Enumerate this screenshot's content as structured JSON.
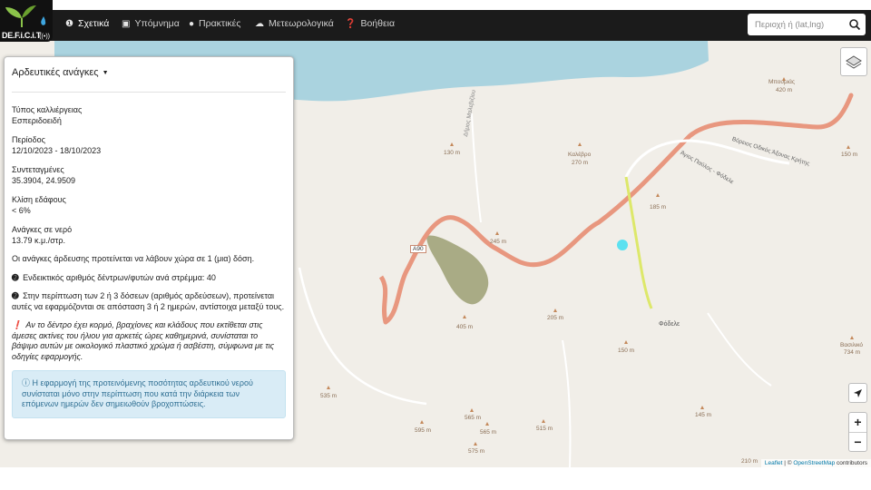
{
  "navbar": {
    "brand": "DE.F.i.C.i.T",
    "items": [
      {
        "label": "Σχετικά",
        "icon": "info-circle-icon",
        "active": true
      },
      {
        "label": "Υπόμνημα",
        "icon": "image-icon",
        "active": false
      },
      {
        "label": "Πρακτικές",
        "icon": "water-drop-icon",
        "active": false
      },
      {
        "label": "Μετεωρολογικά",
        "icon": "cloud-icon",
        "active": false
      },
      {
        "label": "Βοήθεια",
        "icon": "question-circle-icon",
        "active": false
      }
    ],
    "search": {
      "placeholder": "Περιοχή ή (lat,lng)",
      "value": ""
    }
  },
  "panel": {
    "title": "Αρδευτικές ανάγκες",
    "fields": [
      {
        "label": "Τύπος καλλιέργειας",
        "value": "Εσπεριδοειδή"
      },
      {
        "label": "Περίοδος",
        "value": "12/10/2023 - 18/10/2023"
      },
      {
        "label": "Συντεταγμένες",
        "value": "35.3904, 24.9509"
      },
      {
        "label": "Κλίση εδάφους",
        "value": "< 6%"
      },
      {
        "label": "Ανάγκες σε νερό",
        "value": "13.79 κ.μ./στρ."
      }
    ],
    "proposal": "Οι ανάγκες άρδευσης προτείνεται να λάβουν χώρα σε 1 (μια) δόση.",
    "density": "Ενδεικτικός αριθμός δέντρων/φυτών ανά στρέμμα: 40",
    "doses_note": "Στην περίπτωση των 2 ή 3 δόσεων (αριθμός αρδεύσεων), προτείνεται αυτές να εφαρμόζονται σε απόσταση 3 ή 2 ημερών, αντίστοιχα μεταξύ τους.",
    "warning": "Αν το δέντρο έχει κορμό, βραχίονες και κλάδους που εκτίθεται στις άμεσες ακτίνες του ήλιου για αρκετές ώρες καθημερινά, συνίσταται το βάψιμο αυτών με οικολογικό πλαστικό χρώμα ή ασβέστη, σύμφωνα με τις οδηγίες εφαρμογής.",
    "info": "Η εφαρμογή της προτεινόμενης ποσότητας αρδευτικού νερού συνίσταται μόνο στην περίπτωση που κατά την διάρκεια των επόμενων ημερών δεν σημειωθούν βροχοπτώσεις."
  },
  "map": {
    "labels": [
      {
        "name": "Μπουμιάς",
        "elevation": "420 m"
      },
      {
        "name": "Καλέβρο",
        "elevation": "270 m"
      },
      {
        "name": "Φόδελε",
        "elevation": ""
      },
      {
        "name": "Βασιλικό",
        "elevation": "734 m"
      },
      {
        "name": "Δήμος Μαλεβιζίου",
        "elevation": ""
      },
      {
        "name": "Άγιος Παύλος - Φόδελε",
        "elevation": ""
      },
      {
        "name": "Βόρειος Οδικός Άξονας Κρήτης",
        "elevation": ""
      }
    ],
    "road_badge": "A90",
    "elevations": [
      "130 m",
      "185 m",
      "150 m",
      "245 m",
      "205 m",
      "150 m",
      "405 m",
      "535 m",
      "565 m",
      "565 m",
      "515 m",
      "595 m",
      "575 m",
      "145 m",
      "210 m"
    ],
    "attribution": {
      "leaflet": "Leaflet",
      "separator": " | © ",
      "osm": "OpenStreetMap",
      "suffix": " contributors"
    },
    "zoom_in": "+",
    "zoom_out": "−"
  },
  "colors": {
    "navbar": "#1b1b1b",
    "sea": "#aad3df",
    "land": "#f1eee8",
    "road": "#e8977f",
    "track": "#dde86a",
    "marker": "#5ce1f0",
    "info_bg": "#d9ecf6"
  }
}
